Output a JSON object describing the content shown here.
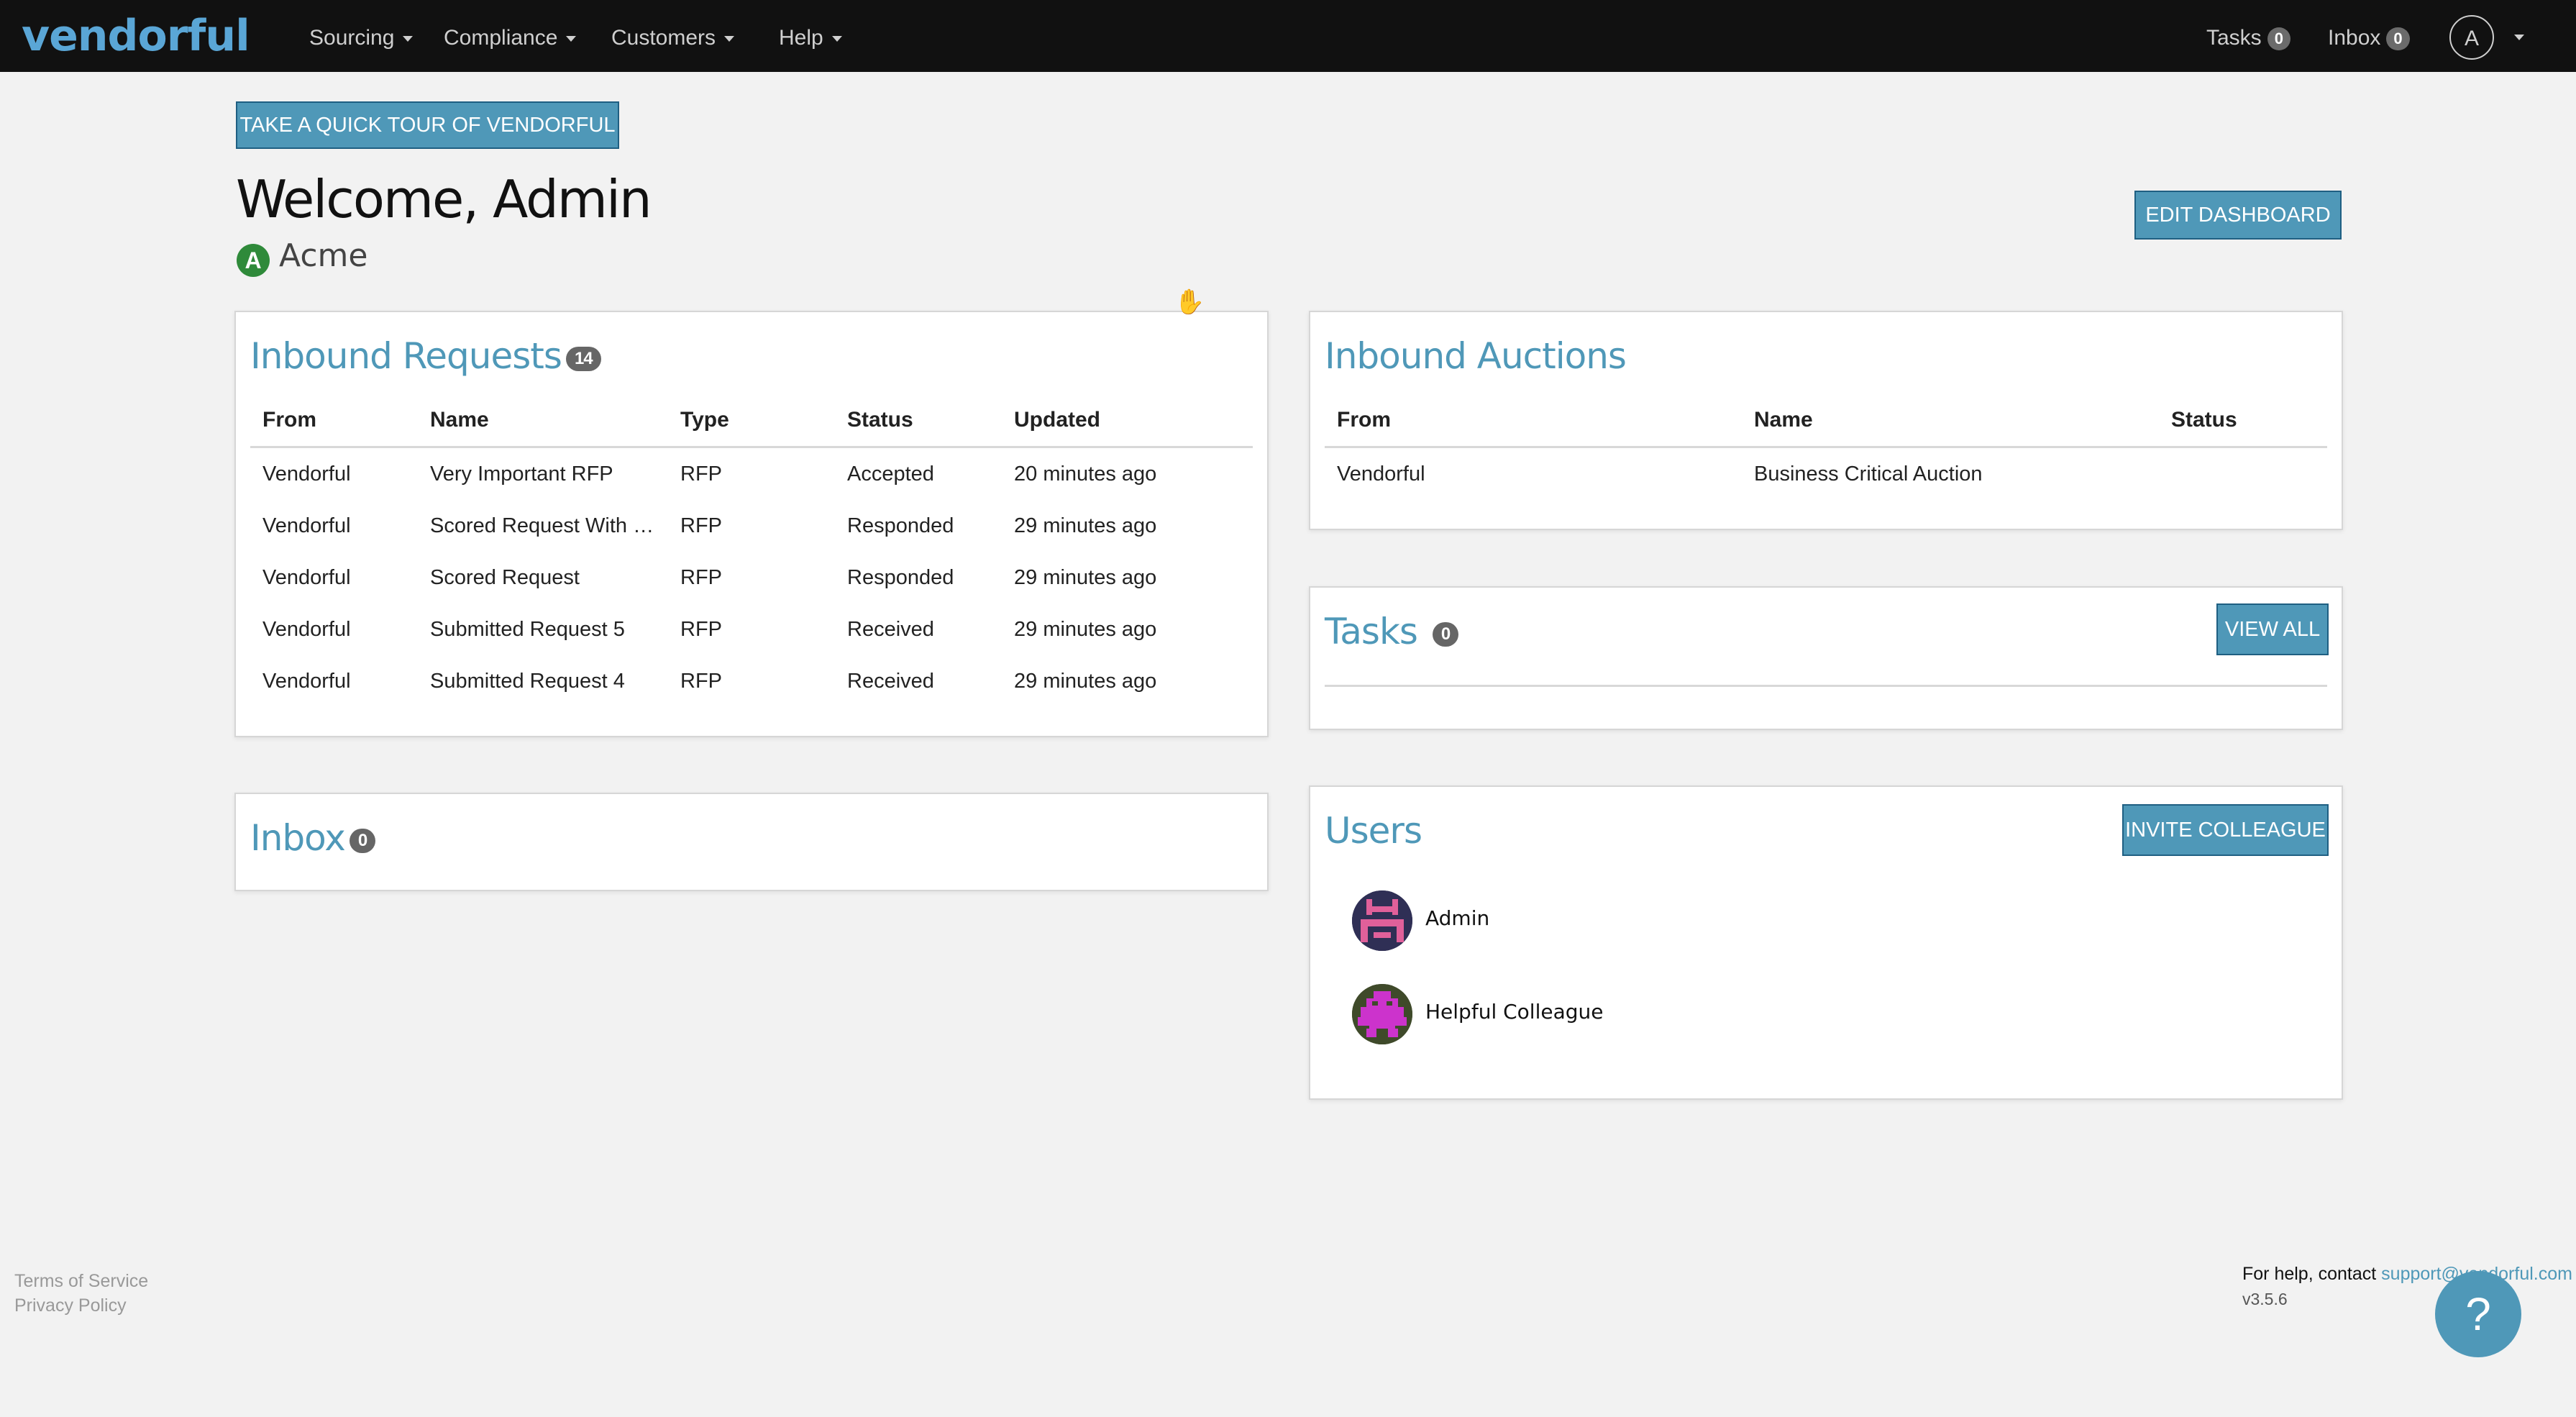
{
  "header": {
    "logo": "vendorful",
    "nav": [
      {
        "label": "Sourcing"
      },
      {
        "label": "Compliance"
      },
      {
        "label": "Customers"
      },
      {
        "label": "Help"
      }
    ],
    "tasks_label": "Tasks",
    "tasks_count": "0",
    "inbox_label": "Inbox",
    "inbox_count": "0",
    "avatar_letter": "A"
  },
  "page": {
    "tour_button": "TAKE A QUICK TOUR OF VENDORFUL",
    "welcome": "Welcome, Admin",
    "org_letter": "A",
    "org_name": "Acme",
    "edit_button": "EDIT DASHBOARD"
  },
  "inbound_requests": {
    "title": "Inbound Requests",
    "count": "14",
    "columns": [
      "From",
      "Name",
      "Type",
      "Status",
      "Updated"
    ],
    "rows": [
      [
        "Vendorful",
        "Very Important RFP",
        "RFP",
        "Accepted",
        "20 minutes ago"
      ],
      [
        "Vendorful",
        "Scored Request With …",
        "RFP",
        "Responded",
        "29 minutes ago"
      ],
      [
        "Vendorful",
        "Scored Request",
        "RFP",
        "Responded",
        "29 minutes ago"
      ],
      [
        "Vendorful",
        "Submitted Request 5",
        "RFP",
        "Received",
        "29 minutes ago"
      ],
      [
        "Vendorful",
        "Submitted Request 4",
        "RFP",
        "Received",
        "29 minutes ago"
      ]
    ]
  },
  "inbox": {
    "title": "Inbox",
    "count": "0"
  },
  "inbound_auctions": {
    "title": "Inbound Auctions",
    "columns": [
      "From",
      "Name",
      "Status"
    ],
    "rows": [
      [
        "Vendorful",
        "Business Critical Auction",
        ""
      ]
    ]
  },
  "tasks": {
    "title": "Tasks",
    "count": "0",
    "view_all": "VIEW ALL"
  },
  "users": {
    "title": "Users",
    "invite_button": "INVITE COLLEAGUE",
    "list": [
      {
        "name": "Admin",
        "avatar_color": "#e0609a"
      },
      {
        "name": "Helpful Colleague",
        "avatar_color": "#cc33cc"
      }
    ]
  },
  "footer": {
    "terms": "Terms of Service",
    "privacy": "Privacy Policy",
    "help_prefix": "For help, contact",
    "support_email": "support@vendorful.com",
    "version": "v3.5.6",
    "help_icon": "?"
  },
  "colors": {
    "accent": "#4f98b8",
    "topbar": "#111111",
    "org_badge": "#2f8a3a"
  }
}
